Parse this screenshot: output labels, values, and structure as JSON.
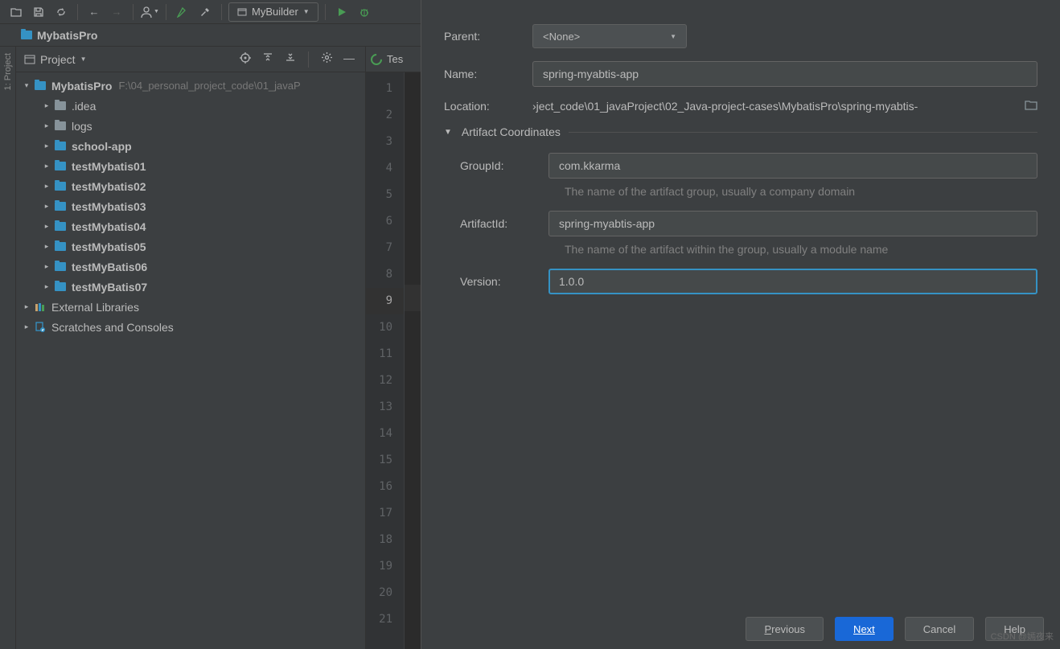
{
  "toolbar": {
    "run_config": "MyBuilder"
  },
  "breadcrumb": {
    "project": "MybatisPro"
  },
  "project_panel": {
    "title": "Project",
    "root": {
      "name": "MybatisPro",
      "path": "F:\\04_personal_project_code\\01_javaP"
    },
    "items": [
      {
        "label": ".idea",
        "type": "folder"
      },
      {
        "label": "logs",
        "type": "folder"
      },
      {
        "label": "school-app",
        "type": "module",
        "bold": true
      },
      {
        "label": "testMybatis01",
        "type": "module",
        "bold": true
      },
      {
        "label": "testMybatis02",
        "type": "module",
        "bold": true
      },
      {
        "label": "testMybatis03",
        "type": "module",
        "bold": true
      },
      {
        "label": "testMybatis04",
        "type": "module",
        "bold": true
      },
      {
        "label": "testMybatis05",
        "type": "module",
        "bold": true
      },
      {
        "label": "testMyBatis06",
        "type": "module",
        "bold": true
      },
      {
        "label": "testMyBatis07",
        "type": "module",
        "bold": true
      }
    ],
    "external": "External Libraries",
    "scratches": "Scratches and Consoles"
  },
  "editor": {
    "tab": "Tes",
    "current_line": 9,
    "line_count": 21
  },
  "dialog": {
    "parent_label": "Parent:",
    "parent_value": "<None>",
    "name_label": "Name:",
    "name_value": "spring-myabtis-app",
    "location_label": "Location:",
    "location_value": "›ject_code\\01_javaProject\\02_Java-project-cases\\MybatisPro\\spring-myabtis-",
    "section": "Artifact Coordinates",
    "groupid_label": "GroupId:",
    "groupid_value": "com.kkarma",
    "groupid_hint": "The name of the artifact group, usually a company domain",
    "artifactid_label": "ArtifactId:",
    "artifactid_value": "spring-myabtis-app",
    "artifactid_hint": "The name of the artifact within the group, usually a module name",
    "version_label": "Version:",
    "version_value": "1.0.0",
    "buttons": {
      "previous": "revious",
      "next": "ext",
      "cancel": "Cancel",
      "help": "Help"
    }
  },
  "watermark": "CSDN @嫣夜来"
}
